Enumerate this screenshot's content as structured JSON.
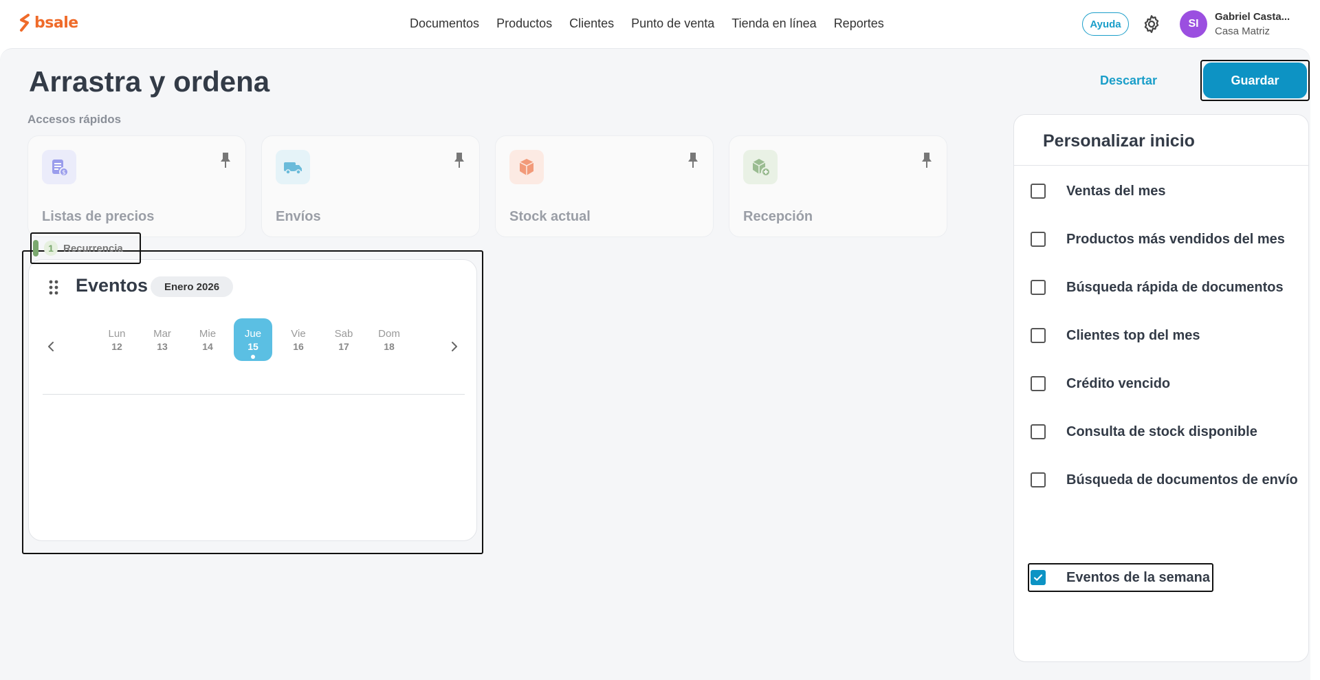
{
  "brand": {
    "name": "bsale",
    "color": "#ef6b2a"
  },
  "nav": {
    "items": [
      "Documentos",
      "Productos",
      "Clientes",
      "Punto de venta",
      "Tienda en línea",
      "Reportes"
    ]
  },
  "header": {
    "help_label": "Ayuda",
    "avatar_initials": "SI",
    "user_name": "Gabriel Casta...",
    "branch": "Casa Matriz"
  },
  "page": {
    "title": "Arrastra y ordena",
    "discard_label": "Descartar",
    "save_label": "Guardar"
  },
  "quick_access": {
    "label": "Accesos rápidos",
    "items": [
      {
        "label": "Listas de precios",
        "icon": "price-list-icon",
        "color": "#7b7fe8"
      },
      {
        "label": "Envíos",
        "icon": "truck-icon",
        "color": "#3aa6d0"
      },
      {
        "label": "Stock actual",
        "icon": "box-icon",
        "color": "#f07a4f"
      },
      {
        "label": "Recepción",
        "icon": "box-add-icon",
        "color": "#7aa86e"
      }
    ]
  },
  "events": {
    "title": "Eventos",
    "month": "Enero 2026",
    "days": [
      {
        "name": "Lun",
        "num": "12"
      },
      {
        "name": "Mar",
        "num": "13"
      },
      {
        "name": "Mie",
        "num": "14"
      },
      {
        "name": "Jue",
        "num": "15",
        "active": true
      },
      {
        "name": "Vie",
        "num": "16"
      },
      {
        "name": "Sab",
        "num": "17"
      },
      {
        "name": "Dom",
        "num": "18"
      }
    ],
    "item": {
      "count": "1",
      "label": "Recurrencia"
    }
  },
  "customize": {
    "title": "Personalizar inicio",
    "options": [
      {
        "label": "Ventas del mes",
        "checked": false
      },
      {
        "label": "Productos más vendidos del mes",
        "checked": false
      },
      {
        "label": "Búsqueda rápida de documentos",
        "checked": false
      },
      {
        "label": "Clientes top del mes",
        "checked": false
      },
      {
        "label": "Crédito vencido",
        "checked": false
      },
      {
        "label": "Consulta de stock disponible",
        "checked": false
      },
      {
        "label": "Búsqueda de documentos de envío",
        "checked": false
      },
      {
        "label": "Eventos de la semana",
        "checked": true
      }
    ]
  }
}
